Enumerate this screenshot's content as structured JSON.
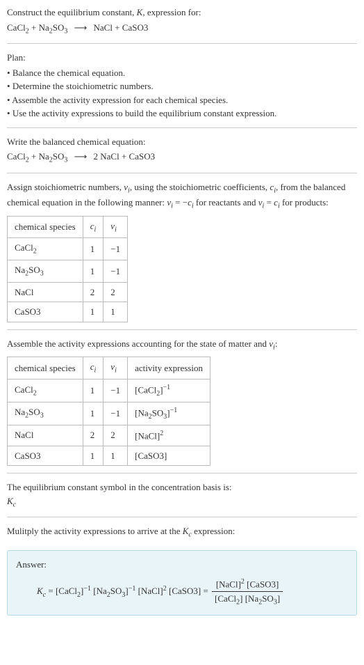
{
  "header": {
    "title_prefix": "Construct the equilibrium constant, ",
    "title_k": "K",
    "title_suffix": ", expression for:",
    "equation_lhs1": "CaCl",
    "equation_lhs1_sub": "2",
    "equation_plus1": " + Na",
    "equation_lhs2_sub": "2",
    "equation_lhs2b": "SO",
    "equation_lhs2b_sub": "3",
    "equation_arrow": "⟶",
    "equation_rhs": " NaCl + CaSO3"
  },
  "plan": {
    "heading": "Plan:",
    "items": [
      "Balance the chemical equation.",
      "Determine the stoichiometric numbers.",
      "Assemble the activity expression for each chemical species.",
      "Use the activity expressions to build the equilibrium constant expression."
    ]
  },
  "balanced": {
    "heading": "Write the balanced chemical equation:",
    "lhs1": "CaCl",
    "lhs1_sub": "2",
    "plus1": " + Na",
    "lhs2_sub": "2",
    "lhs2b": "SO",
    "lhs2b_sub": "3",
    "arrow": "⟶",
    "rhs": " 2 NaCl + CaSO3"
  },
  "stoich": {
    "heading_a": "Assign stoichiometric numbers, ",
    "nu": "ν",
    "i": "i",
    "heading_b": ", using the stoichiometric coefficients, ",
    "c": "c",
    "heading_c": ", from the balanced chemical equation in the following manner: ",
    "rule1": " = −",
    "heading_d": " for reactants and ",
    "rule2": " = ",
    "heading_e": " for products:",
    "col1": "chemical species",
    "col2_c": "c",
    "col2_i": "i",
    "col3_nu": "ν",
    "col3_i": "i",
    "rows": [
      {
        "species_a": "CaCl",
        "species_sub": "2",
        "species_b": "",
        "ci": "1",
        "nui": "−1"
      },
      {
        "species_a": "Na",
        "species_sub": "2",
        "species_b": "SO",
        "species_sub2": "3",
        "ci": "1",
        "nui": "−1"
      },
      {
        "species_a": "NaCl",
        "species_sub": "",
        "species_b": "",
        "ci": "2",
        "nui": "2"
      },
      {
        "species_a": "CaSO3",
        "species_sub": "",
        "species_b": "",
        "ci": "1",
        "nui": "1"
      }
    ]
  },
  "activity": {
    "heading_a": "Assemble the activity expressions accounting for the state of matter and ",
    "heading_b": ":",
    "col1": "chemical species",
    "col4": "activity expression",
    "rows": [
      {
        "species_a": "CaCl",
        "species_sub": "2",
        "ci": "1",
        "nui": "−1",
        "act_a": "[CaCl",
        "act_sub": "2",
        "act_b": "]",
        "act_exp": "−1"
      },
      {
        "species_a": "Na",
        "species_sub": "2",
        "species_b": "SO",
        "species_sub2": "3",
        "ci": "1",
        "nui": "−1",
        "act_a": "[Na",
        "act_sub": "2",
        "act_mid": "SO",
        "act_sub2": "3",
        "act_b": "]",
        "act_exp": "−1"
      },
      {
        "species_a": "NaCl",
        "ci": "2",
        "nui": "2",
        "act_a": "[NaCl]",
        "act_exp": "2"
      },
      {
        "species_a": "CaSO3",
        "ci": "1",
        "nui": "1",
        "act_a": "[CaSO3]"
      }
    ]
  },
  "symbol": {
    "heading": "The equilibrium constant symbol in the concentration basis is:",
    "K": "K",
    "c": "c"
  },
  "multiply": {
    "heading_a": "Mulitply the activity expressions to arrive at the ",
    "heading_b": " expression:"
  },
  "answer": {
    "label": "Answer:",
    "Kc_K": "K",
    "Kc_c": "c",
    "eq": " = ",
    "t1a": "[CaCl",
    "t1s": "2",
    "t1b": "]",
    "t1e": "−1",
    "t2a": " [Na",
    "t2s": "2",
    "t2m": "SO",
    "t2s2": "3",
    "t2b": "]",
    "t2e": "−1",
    "t3a": " [NaCl]",
    "t3e": "2",
    "t4": " [CaSO3] = ",
    "num_a": "[NaCl]",
    "num_e": "2",
    "num_b": " [CaSO3]",
    "den_a": "[CaCl",
    "den_s": "2",
    "den_b": "] [Na",
    "den_s2": "2",
    "den_m": "SO",
    "den_s3": "3",
    "den_c": "]"
  }
}
